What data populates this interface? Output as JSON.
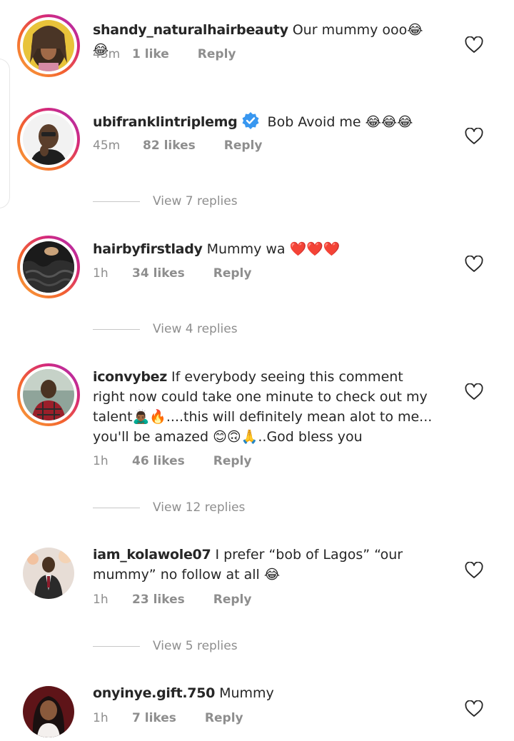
{
  "comments": [
    {
      "username": "shandy_naturalhairbeauty",
      "text": "Our mummy ooo",
      "emoji": "😂😂",
      "time": "43m",
      "likes": "1 like",
      "reply": "Reply"
    },
    {
      "username": "ubifranklintriplemg",
      "verified": true,
      "text": "Bob Avoid me",
      "emoji": "😂😂😂",
      "time": "45m",
      "likes": "82 likes",
      "reply": "Reply",
      "view_replies": "View 7 replies"
    },
    {
      "username": "hairbyfirstlady",
      "text": "Mummy wa",
      "emoji": "❤️❤️❤️",
      "time": "1h",
      "likes": "34 likes",
      "reply": "Reply",
      "view_replies": "View 4 replies"
    },
    {
      "username": "iconvybez",
      "text_part1": "If everybody seeing this comment right now could take one minute to check out my talent",
      "emoji_part1": "🙇🏾‍♂️🔥",
      "text_part2": "....this will definitely mean alot to me... you'll be amazed",
      "emoji_part2": "😊🙃🙏",
      "text_part3": "..God bless you",
      "time": "1h",
      "likes": "46 likes",
      "reply": "Reply",
      "view_replies": "View 12 replies"
    },
    {
      "username": "iam_kolawole07",
      "text": "I prefer “bob of Lagos” “our mummy” no follow at all",
      "emoji": "😂",
      "time": "1h",
      "likes": "23 likes",
      "reply": "Reply",
      "view_replies": "View 5 replies"
    },
    {
      "username": "onyinye.gift.750",
      "text": "Mummy",
      "time": "1h",
      "likes": "7 likes",
      "reply": "Reply"
    }
  ],
  "icons": {
    "like": "heart-outline-icon",
    "verified": "verified-badge-icon"
  },
  "colors": {
    "text": "#262626",
    "secondary": "#8e8e8e",
    "verified": "#3897f0",
    "story_ring_start": "#f9a53a",
    "story_ring_end": "#a62ec0"
  }
}
